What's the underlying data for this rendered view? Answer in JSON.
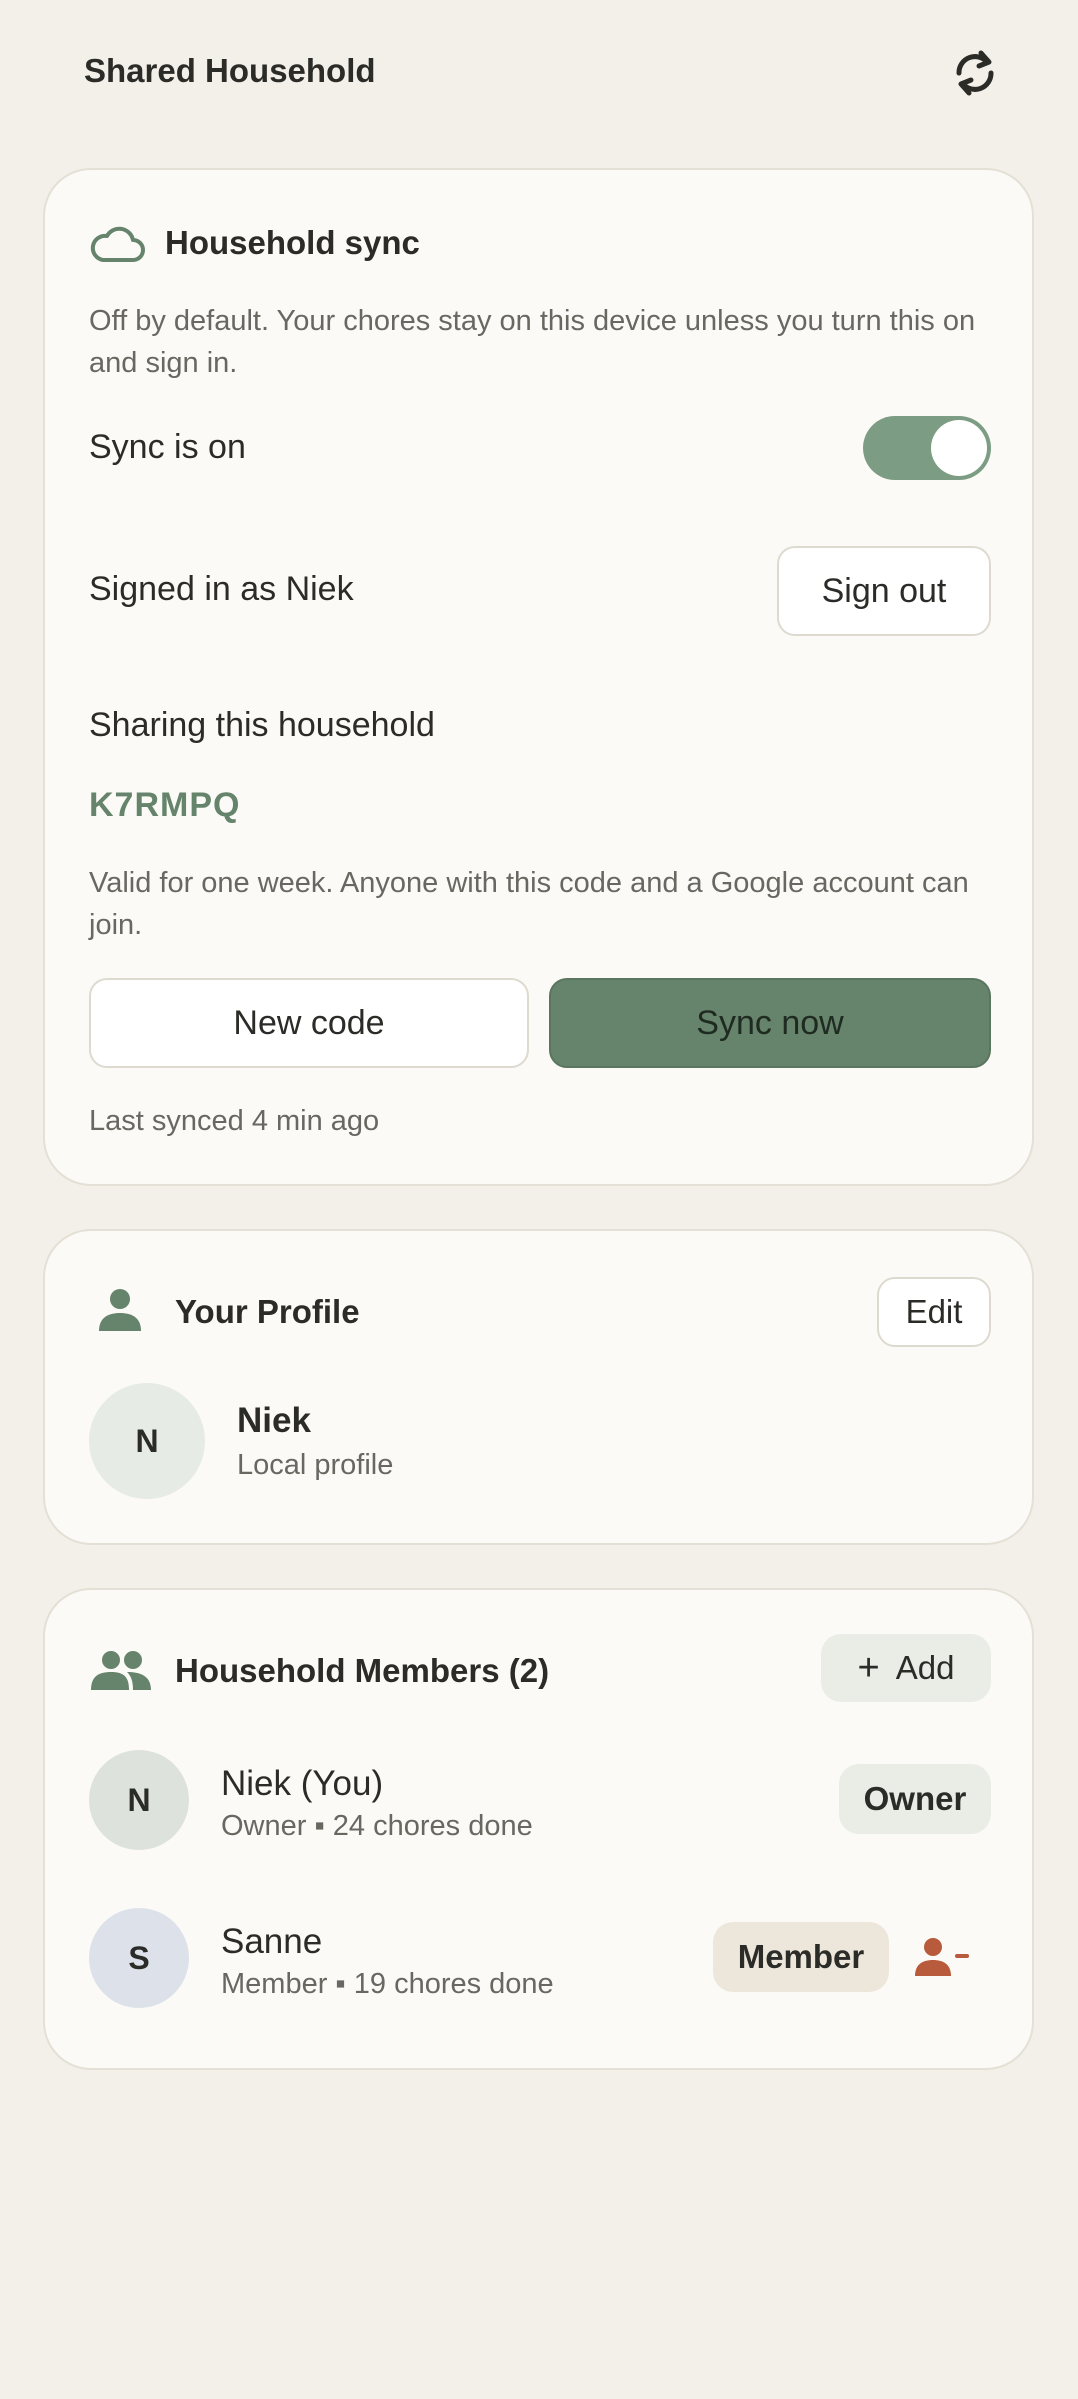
{
  "header": {
    "title": "Shared Household",
    "refresh_icon": "sync-icon"
  },
  "sync": {
    "title": "Household sync",
    "description": "Off by default. Your chores stay on this device unless you turn this on and sign in.",
    "toggle_label": "Sync is on",
    "toggle_on": true,
    "signed_in_text": "Signed in as Niek",
    "sign_out_label": "Sign out",
    "sharing_label": "Sharing this household",
    "code": "K7RMPQ",
    "code_note": "Valid for one week. Anyone with this code and a Google account can join.",
    "new_code_label": "New code",
    "sync_now_label": "Sync now",
    "last_synced": "Last synced 4 min ago"
  },
  "profile": {
    "title": "Your Profile",
    "edit_label": "Edit",
    "avatar_initial": "N",
    "name": "Niek",
    "subtitle": "Local profile"
  },
  "members": {
    "title": "Household Members (2)",
    "add_label": "Add",
    "list": [
      {
        "initial": "N",
        "name": "Niek (You)",
        "detail": "Owner ▪ 24 chores done",
        "role": "Owner"
      },
      {
        "initial": "S",
        "name": "Sanne",
        "detail": "Member ▪ 19 chores done",
        "role": "Member"
      }
    ]
  },
  "colors": {
    "accent": "#66836b",
    "background": "#f3f0e9",
    "card": "#fbfaf7",
    "danger": "#b85a3c"
  }
}
